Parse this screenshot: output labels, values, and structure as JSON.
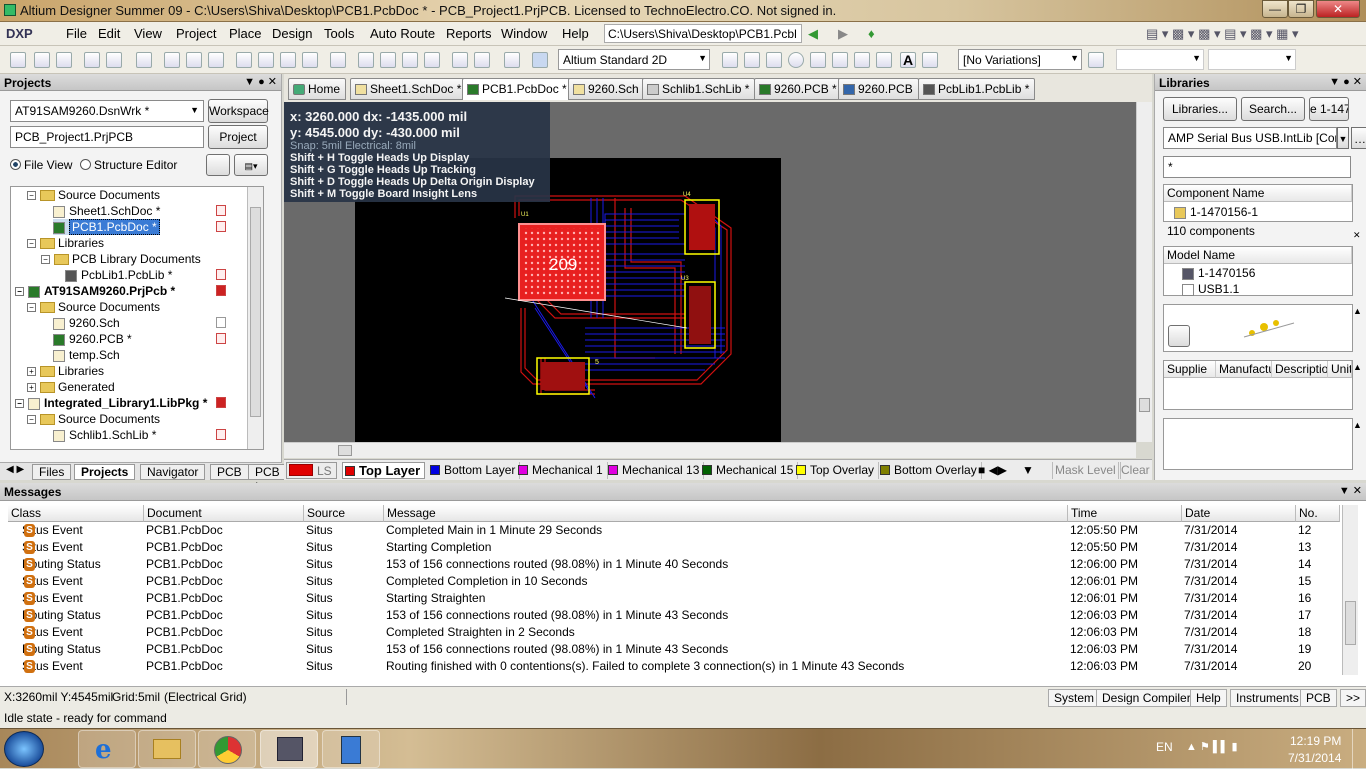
{
  "window": {
    "title": "Altium Designer Summer 09 - C:\\Users\\Shiva\\Desktop\\PCB1.PcbDoc * - PCB_Project1.PrjPCB. Licensed to TechnoElectro.CO. Not signed in."
  },
  "menu": {
    "items": [
      "DXP",
      "File",
      "Edit",
      "View",
      "Project",
      "Place",
      "Design",
      "Tools",
      "Auto Route",
      "Reports",
      "Window",
      "Help"
    ],
    "path": "C:\\Users\\Shiva\\Desktop\\PCB1.Pcbl"
  },
  "toolbar": {
    "view_mode": "Altium Standard 2D",
    "variations": "[No Variations]"
  },
  "projects_panel": {
    "title": "Projects",
    "workspace_value": "AT91SAM9260.DsnWrk *",
    "workspace_button": "Workspace",
    "project_value": "PCB_Project1.PrjPCB",
    "project_button": "Project",
    "file_view": "File View",
    "structure_editor": "Structure Editor",
    "tree": [
      "Source Documents",
      "Sheet1.SchDoc *",
      "PCB1.PcbDoc *",
      "Libraries",
      "PCB Library Documents",
      "PcbLib1.PcbLib *",
      "AT91SAM9260.PrjPcb *",
      "Source Documents",
      "9260.Sch",
      "9260.PCB *",
      "temp.Sch",
      "Libraries",
      "Generated",
      "Integrated_Library1.LibPkg *",
      "Source Documents",
      "Schlib1.SchLib *"
    ],
    "tabs": [
      "Files",
      "Projects",
      "Navigator",
      "PCB",
      "PCB I"
    ]
  },
  "doc_tabs": [
    "Home",
    "Sheet1.SchDoc *",
    "PCB1.PcbDoc *",
    "9260.Sch",
    "Schlib1.SchLib *",
    "9260.PCB *",
    "9260.PCB",
    "PcbLib1.PcbLib *"
  ],
  "hud": {
    "line1": "x:  3260.000    dx:  -1435.000  mil",
    "line2": "y:  4545.000    dy:   -430.000  mil",
    "snap": "Snap: 5mil Electrical: 8mil",
    "h1": "Shift + H   Toggle Heads Up Display",
    "h2": "Shift + G   Toggle Heads Up Tracking",
    "h3": "Shift + D   Toggle Heads Up Delta Origin Display",
    "h4": "Shift + M   Toggle Board Insight Lens"
  },
  "board": {
    "chip_label": "209",
    "u1": "U1",
    "u3": "U3",
    "u4": "U4",
    "s5": "5"
  },
  "layers": {
    "ls": "LS",
    "items": [
      "Top Layer",
      "Bottom Layer",
      "Mechanical 1",
      "Mechanical 13",
      "Mechanical 15",
      "Top Overlay",
      "Bottom Overlay"
    ],
    "colors": [
      "#e00000",
      "#0000e0",
      "#e000e0",
      "#e000e0",
      "#006000",
      "#ffff00",
      "#808000"
    ],
    "mask_level": "Mask Level",
    "clear": "Clear"
  },
  "libraries_panel": {
    "title": "Libraries",
    "libraries_button": "Libraries...",
    "search_button": "Search...",
    "part_field": "e 1-147",
    "library": "AMP Serial Bus USB.IntLib [Con",
    "filter": "*",
    "component_header": "Component Name",
    "component_item": "1-1470156-1",
    "component_count": "110 components",
    "model_header": "Model Name",
    "models": [
      "1-1470156",
      "USB1.1"
    ],
    "supplier_cols": [
      "Supplie",
      "Manufactu",
      "Descriptio",
      "Unit"
    ]
  },
  "messages": {
    "title": "Messages",
    "columns": [
      "Class",
      "Document",
      "Source",
      "Message",
      "Time",
      "Date",
      "No."
    ],
    "rows": [
      [
        "Situs Event",
        "PCB1.PcbDoc",
        "Situs",
        "Completed Main in 1 Minute 29 Seconds",
        "12:05:50 PM",
        "7/31/2014",
        "12"
      ],
      [
        "Situs Event",
        "PCB1.PcbDoc",
        "Situs",
        "Starting Completion",
        "12:05:50 PM",
        "7/31/2014",
        "13"
      ],
      [
        "Routing Status",
        "PCB1.PcbDoc",
        "Situs",
        "153 of 156 connections routed (98.08%) in 1 Minute 40 Seconds",
        "12:06:00 PM",
        "7/31/2014",
        "14"
      ],
      [
        "Situs Event",
        "PCB1.PcbDoc",
        "Situs",
        "Completed Completion in 10 Seconds",
        "12:06:01 PM",
        "7/31/2014",
        "15"
      ],
      [
        "Situs Event",
        "PCB1.PcbDoc",
        "Situs",
        "Starting Straighten",
        "12:06:01 PM",
        "7/31/2014",
        "16"
      ],
      [
        "Routing Status",
        "PCB1.PcbDoc",
        "Situs",
        "153 of 156 connections routed (98.08%) in 1 Minute 43 Seconds",
        "12:06:03 PM",
        "7/31/2014",
        "17"
      ],
      [
        "Situs Event",
        "PCB1.PcbDoc",
        "Situs",
        "Completed Straighten in 2 Seconds",
        "12:06:03 PM",
        "7/31/2014",
        "18"
      ],
      [
        "Routing Status",
        "PCB1.PcbDoc",
        "Situs",
        "153 of 156 connections routed (98.08%) in 1 Minute 43 Seconds",
        "12:06:03 PM",
        "7/31/2014",
        "19"
      ],
      [
        "Situs Event",
        "PCB1.PcbDoc",
        "Situs",
        "Routing finished  with 0 contentions(s). Failed to complete 3 connection(s) in 1 Minute 43 Seconds",
        "12:06:03 PM",
        "7/31/2014",
        "20"
      ]
    ]
  },
  "status": {
    "coords": "X:3260mil Y:4545mil",
    "grid": "Grid:5mil",
    "grid_mode": "(Electrical Grid)",
    "idle": "Idle state - ready for command",
    "tabs": [
      "System",
      "Design Compiler",
      "Help",
      "Instruments",
      "PCB"
    ]
  },
  "taskbar": {
    "lang": "EN",
    "time": "12:19 PM",
    "date": "7/31/2014"
  }
}
